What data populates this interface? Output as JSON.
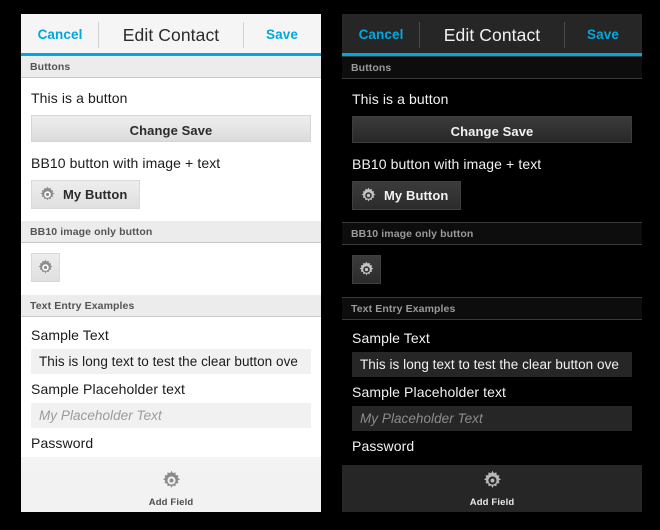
{
  "panels": [
    {
      "theme": "light",
      "titlebar": {
        "cancel": "Cancel",
        "title": "Edit Contact",
        "save": "Save"
      },
      "sections": {
        "buttons_header": "Buttons",
        "image_only_header": "BB10 image only button",
        "text_entry_header": "Text Entry Examples"
      },
      "fields": {
        "button_label": "This is a button",
        "change_save": "Change Save",
        "image_text_label": "BB10 button with image + text",
        "my_button": "My Button",
        "sample_text_label": "Sample Text",
        "sample_text_value": "This is long text to test the clear button ove",
        "placeholder_label": "Sample Placeholder text",
        "placeholder_value": "My Placeholder Text",
        "password_label": "Password"
      },
      "action_bar": {
        "label": "Add Field",
        "icon": "gear-icon"
      },
      "colors": {
        "accent": "#00a8e0",
        "background": "#f4f4f4",
        "content": "#ffffff",
        "titlebar": "#f5f5f5",
        "section_header": "#ececec",
        "button": "#e6e6e6",
        "input": "#f1f1f1",
        "text": "#1b1b1b"
      }
    },
    {
      "theme": "dark",
      "titlebar": {
        "cancel": "Cancel",
        "title": "Edit Contact",
        "save": "Save"
      },
      "sections": {
        "buttons_header": "Buttons",
        "image_only_header": "BB10 image only button",
        "text_entry_header": "Text Entry Examples"
      },
      "fields": {
        "button_label": "This is a button",
        "change_save": "Change Save",
        "image_text_label": "BB10 button with image + text",
        "my_button": "My Button",
        "sample_text_label": "Sample Text",
        "sample_text_value": "This is long text to test the clear button ove",
        "placeholder_label": "Sample Placeholder text",
        "placeholder_value": "My Placeholder Text",
        "password_label": "Password"
      },
      "action_bar": {
        "label": "Add Field",
        "icon": "gear-icon"
      },
      "colors": {
        "accent": "#00a8e0",
        "background": "#000000",
        "content": "#000000",
        "titlebar": "#262626",
        "section_header": "#0d0d0d",
        "button": "#333333",
        "input": "#262626",
        "text": "#f2f2f2"
      }
    }
  ]
}
